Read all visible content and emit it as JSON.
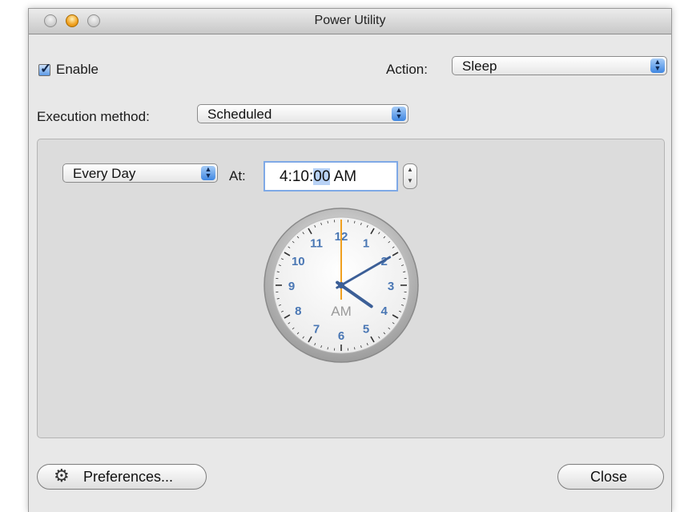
{
  "window": {
    "title": "Power Utility"
  },
  "enable": {
    "label": "Enable",
    "checked": true
  },
  "action": {
    "label": "Action:",
    "value": "Sleep"
  },
  "execution": {
    "label": "Execution method:",
    "value": "Scheduled"
  },
  "schedule": {
    "frequency": "Every Day",
    "at_label": "At:",
    "time_prefix": "4:10:",
    "time_selected": "00",
    "time_suffix": " AM"
  },
  "clock": {
    "hour": 4,
    "minute": 10,
    "second": 0,
    "period_label": "AM",
    "numbers": [
      "12",
      "1",
      "2",
      "3",
      "4",
      "5",
      "6",
      "7",
      "8",
      "9",
      "10",
      "11"
    ],
    "number_color": "#4a77b4",
    "hand_color": "#3c5f97",
    "second_hand_color": "#f0a020"
  },
  "buttons": {
    "preferences": "Preferences...",
    "close": "Close"
  },
  "icons": {
    "preferences": "gear-icon"
  }
}
